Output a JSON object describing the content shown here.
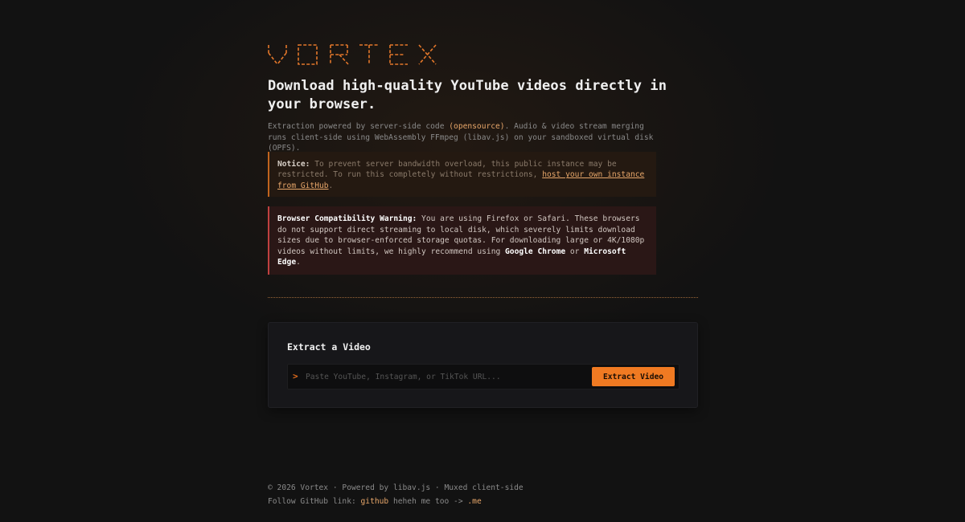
{
  "brand": {
    "name": "VORTEX",
    "accent": "#f07a22"
  },
  "hero": {
    "headline": "Download high-quality YouTube videos directly in your browser.",
    "desc_prefix": "Extraction powered by server-side code ",
    "desc_link": "(opensource)",
    "desc_suffix": ". Audio & video stream merging runs client-side using WebAssembly FFmpeg (libav.js) on your sandboxed virtual disk (OPFS)."
  },
  "notice": {
    "label": "Notice:",
    "text": " To prevent server bandwidth overload, this public instance may be restricted. To run this completely without restrictions, ",
    "link": "host your own instance from GitHub",
    "end": "."
  },
  "warning": {
    "label": "Browser Compatibility Warning:",
    "text": " You are using Firefox or Safari. These browsers do not support direct streaming to local disk, which severely limits download sizes due to browser-enforced storage quotas. For downloading large or 4K/1080p videos without limits, we highly recommend using ",
    "browser1": "Google Chrome",
    "or": " or ",
    "browser2": "Microsoft Edge",
    "end": "."
  },
  "extract": {
    "title": "Extract a Video",
    "prompt": ">",
    "placeholder": "Paste YouTube, Instagram, or TikTok URL...",
    "value": "",
    "button": "Extract Video"
  },
  "footer": {
    "line1": "© 2026 Vortex · Powered by libav.js · Muxed client-side",
    "line2_prefix": "Follow GitHub link: ",
    "github": "github",
    "middle": " heheh me too -> ",
    "me": ".me"
  }
}
